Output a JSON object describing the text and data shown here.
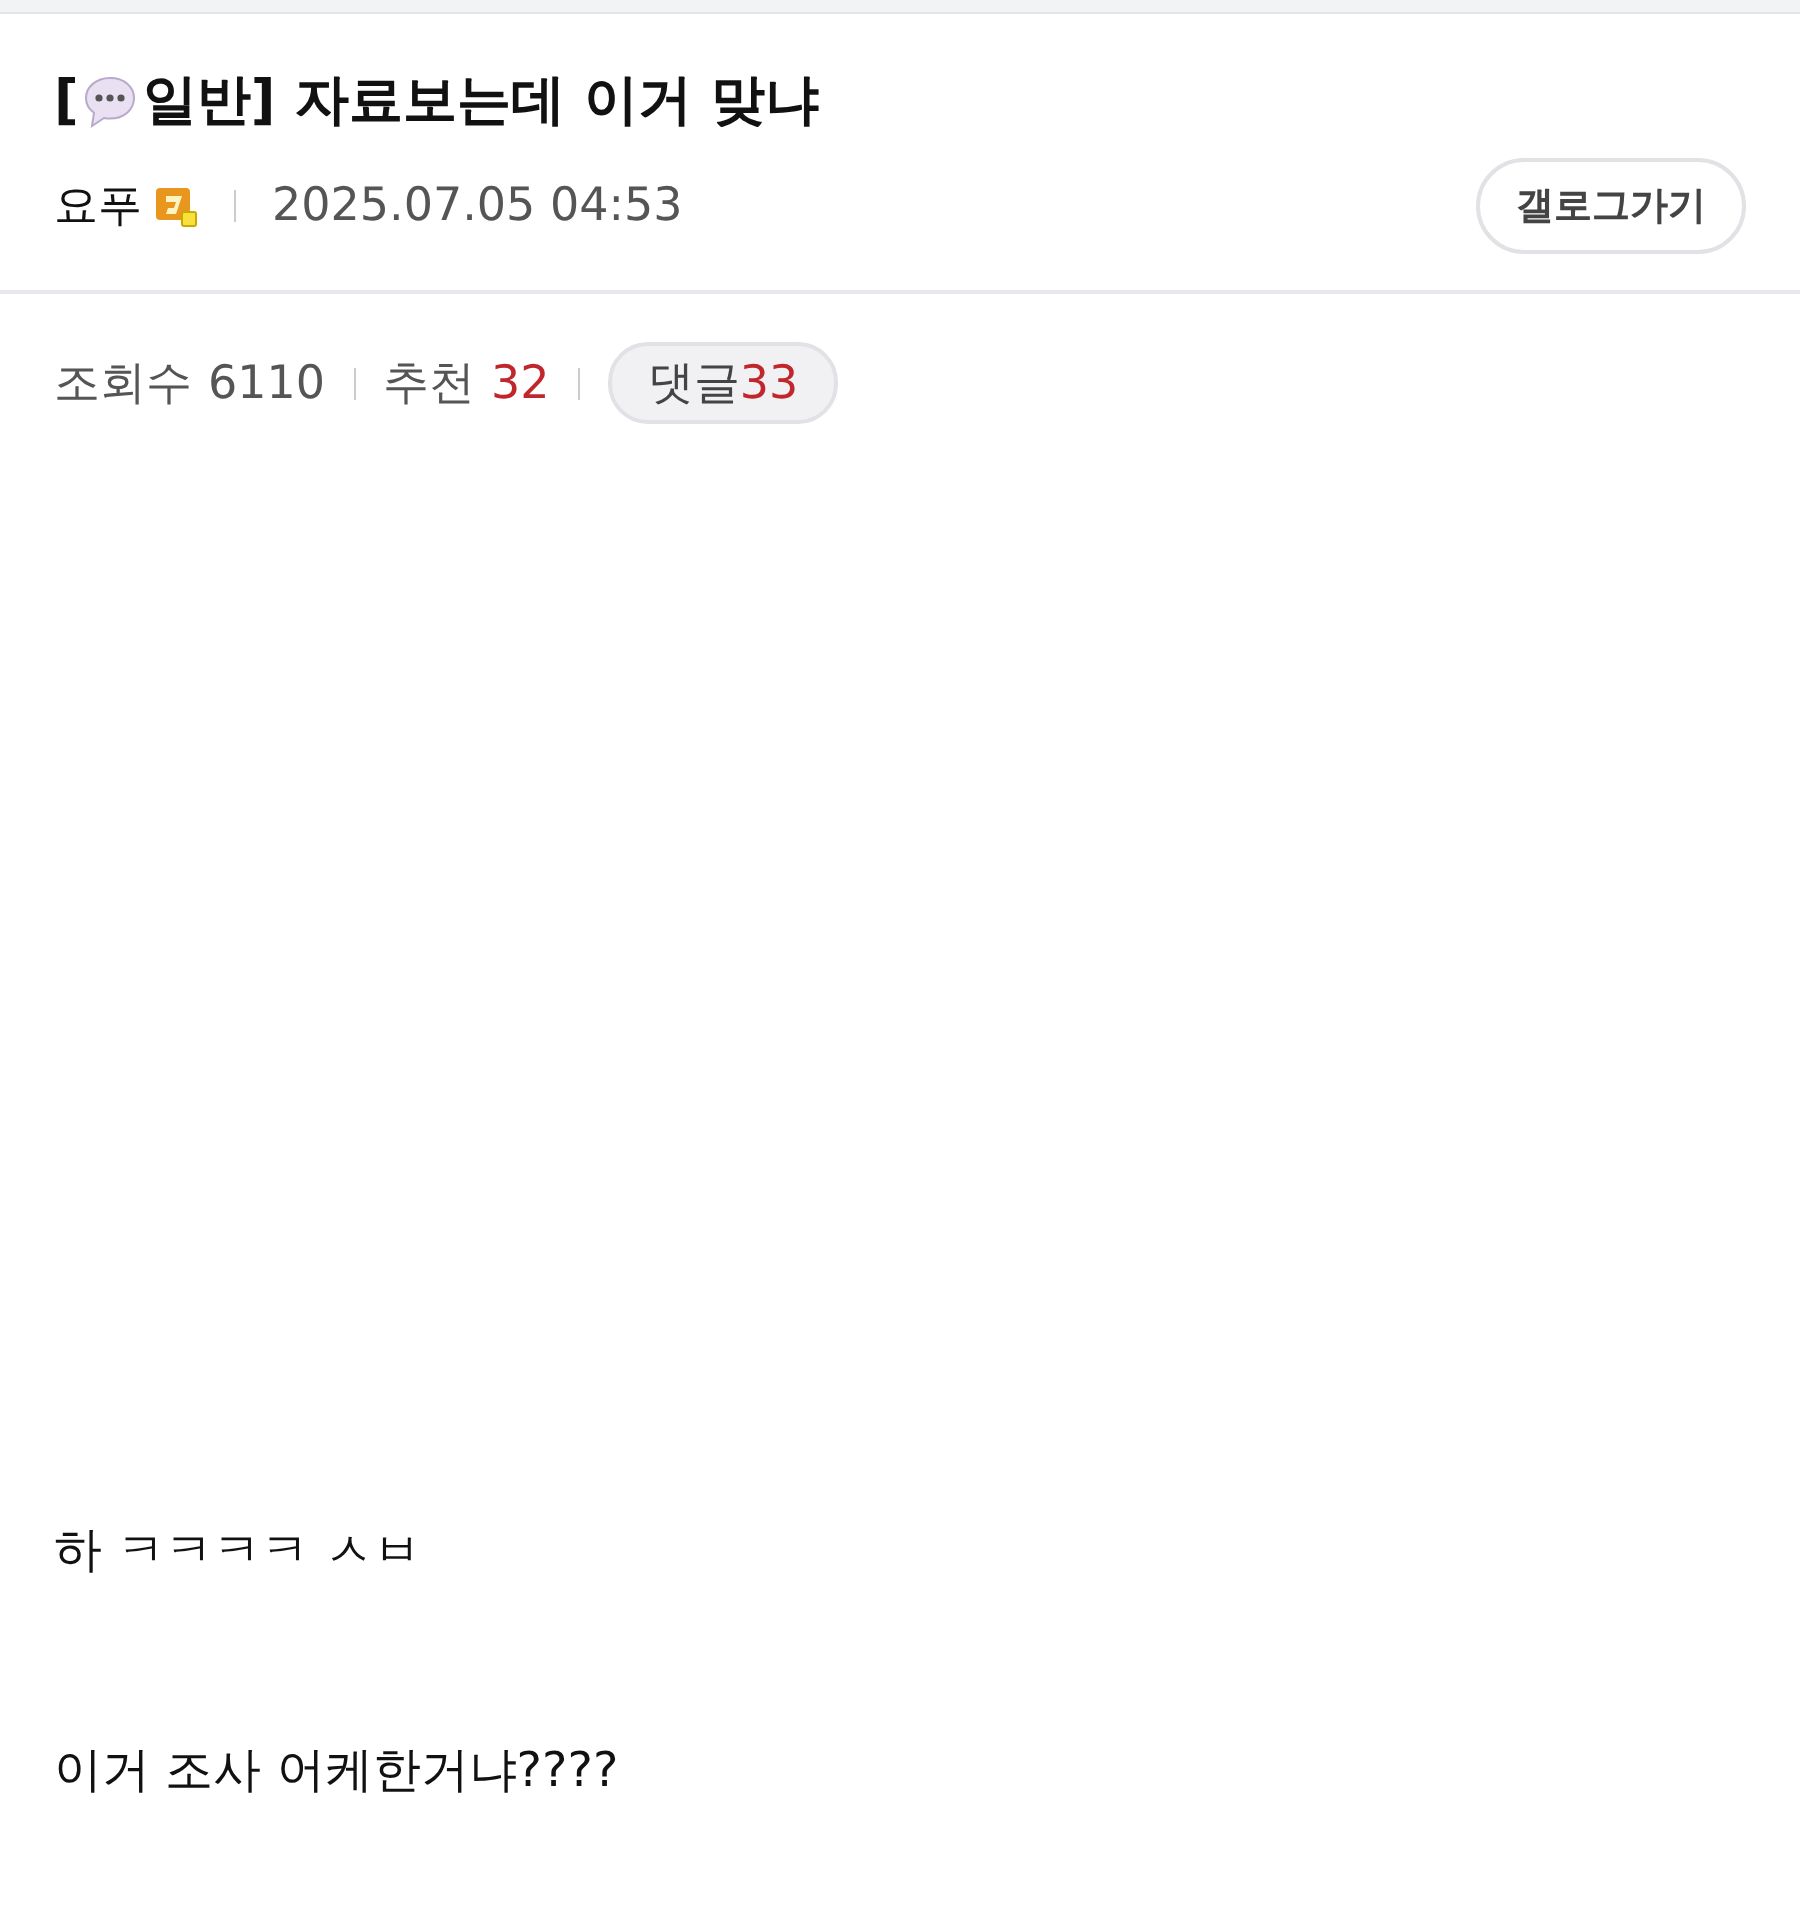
{
  "post": {
    "title_open": "[",
    "category": "일반]",
    "title": "자료보는데 이거 맞냐",
    "author": "요푸",
    "date": "2025.07.05 04:53",
    "gallog_button": "갤로그가기"
  },
  "stats": {
    "views_label": "조회수",
    "views": "6110",
    "likes_label": "추천",
    "likes": "32",
    "comments_label": "댓글",
    "comments": "33"
  },
  "body": [
    "하 ㅋㅋㅋㅋ ㅅㅂ",
    "이거 조사 어케한거냐????"
  ]
}
